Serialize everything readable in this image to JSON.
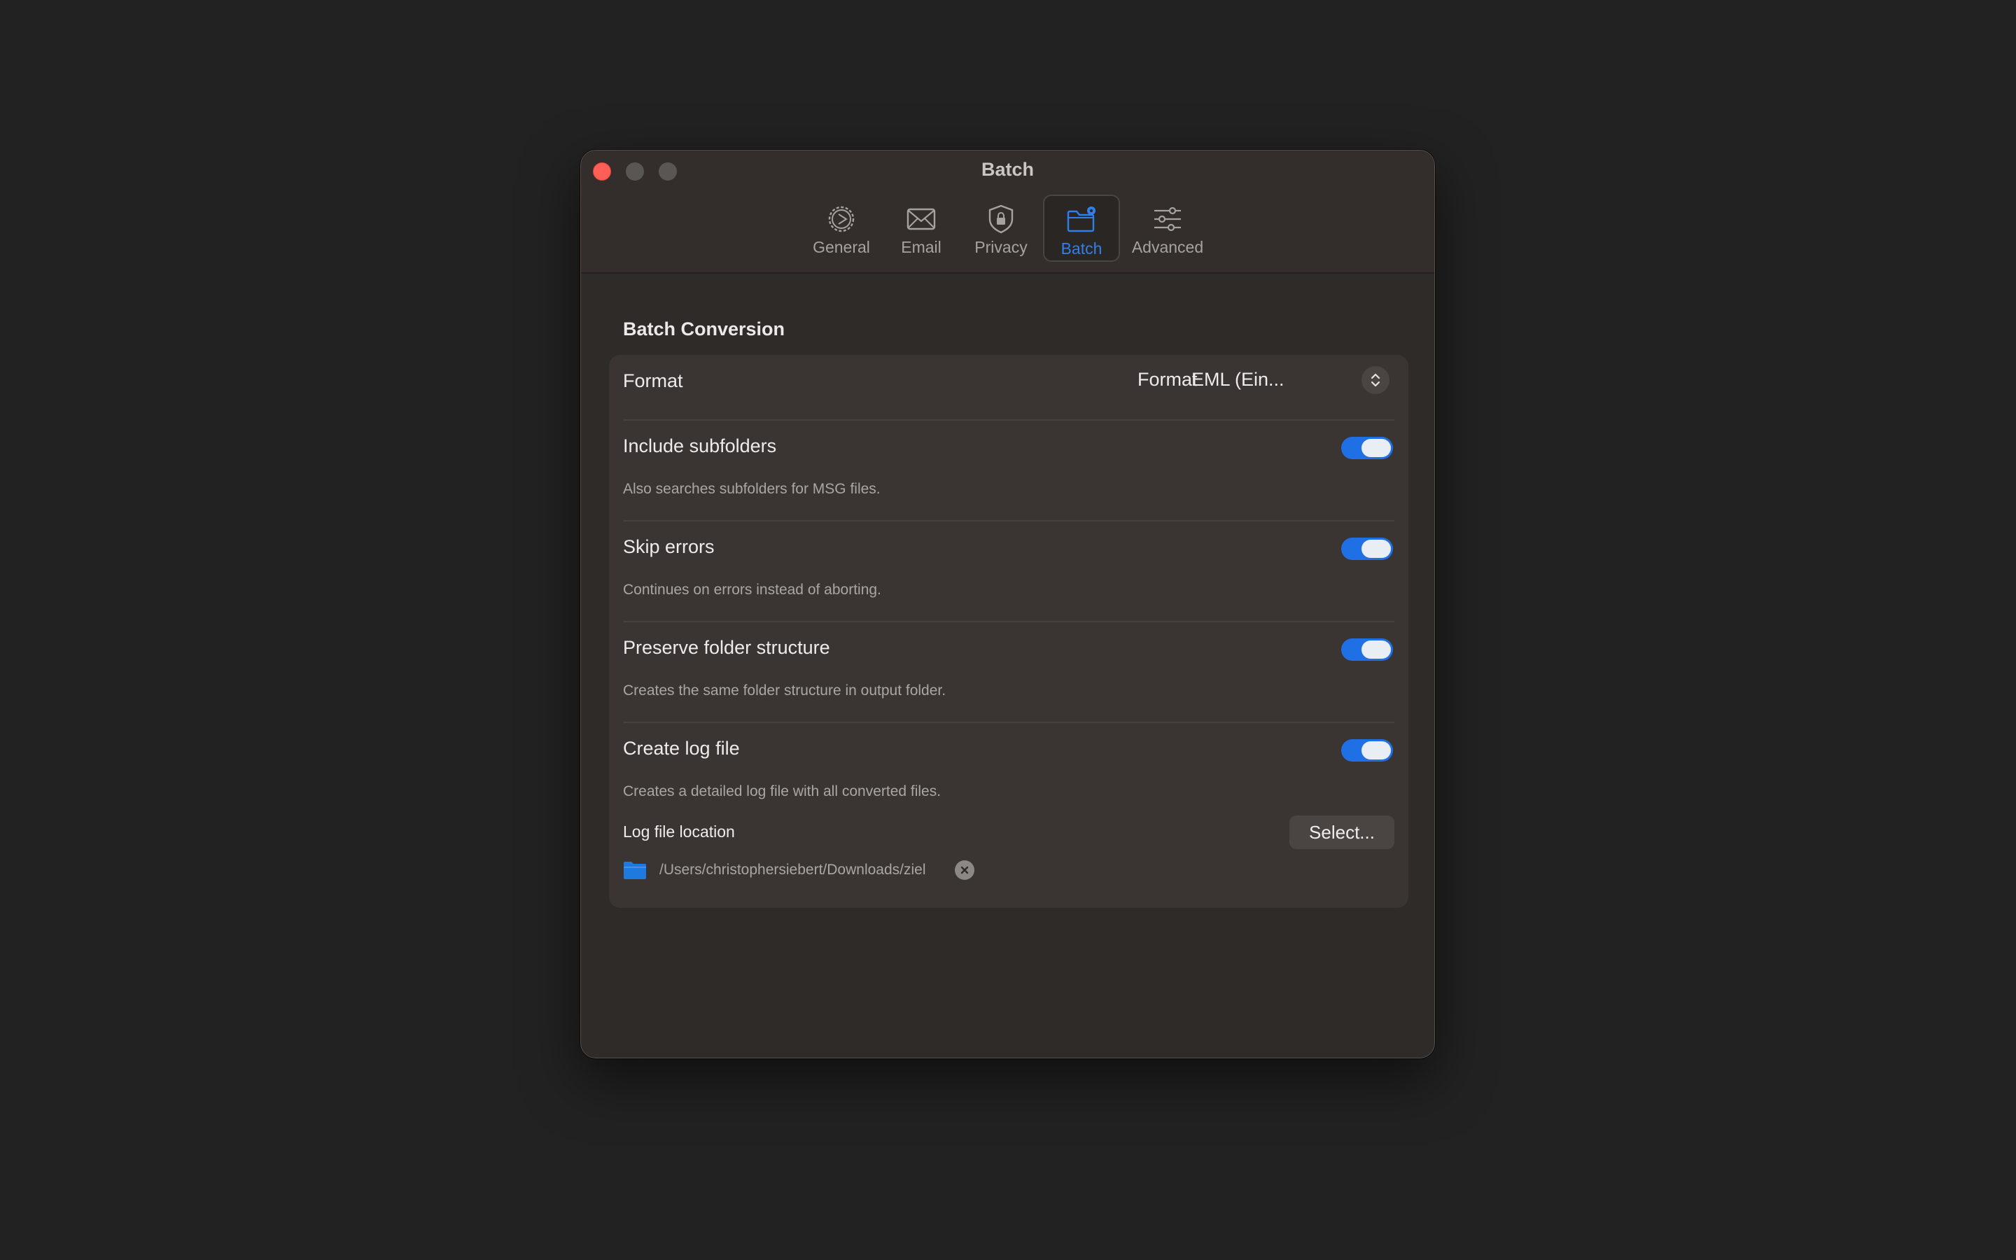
{
  "window": {
    "title": "Batch"
  },
  "tabs": [
    {
      "label": "General",
      "icon": "gear-icon"
    },
    {
      "label": "Email",
      "icon": "envelope-icon"
    },
    {
      "label": "Privacy",
      "icon": "shield-lock-icon"
    },
    {
      "label": "Batch",
      "icon": "folder-gear-icon",
      "active": true
    },
    {
      "label": "Advanced",
      "icon": "sliders-icon"
    }
  ],
  "section": {
    "title": "Batch Conversion"
  },
  "format": {
    "label": "Format",
    "picker_label": "Format",
    "picker_value": "EML (Ein..."
  },
  "settings": [
    {
      "title": "Include subfolders",
      "description": "Also searches subfolders for MSG files.",
      "enabled": true
    },
    {
      "title": "Skip errors",
      "description": "Continues on errors instead of aborting.",
      "enabled": true
    },
    {
      "title": "Preserve folder structure",
      "description": "Creates the same folder structure in output folder.",
      "enabled": true
    },
    {
      "title": "Create log file",
      "description": "Creates a detailed log file with all converted files.",
      "enabled": true
    }
  ],
  "log_location": {
    "label": "Log file location",
    "select_label": "Select...",
    "path": "/Users/christophersiebert/Downloads/ziel"
  },
  "colors": {
    "accent": "#1f6fe5",
    "window_bg": "#2f2b29",
    "card_bg": "#3a3533",
    "desktop_bg": "#222222"
  }
}
